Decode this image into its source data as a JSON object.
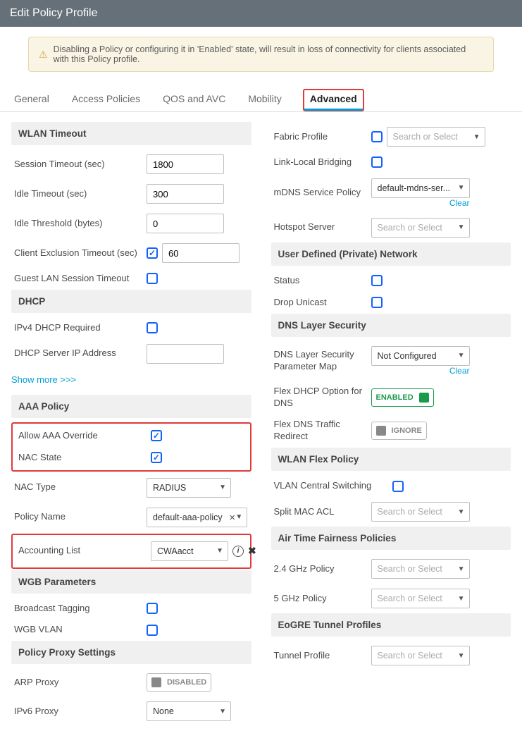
{
  "header": {
    "title": "Edit Policy Profile"
  },
  "warning": {
    "text": "Disabling a Policy or configuring it in 'Enabled' state, will result in loss of connectivity for clients associated with this Policy profile."
  },
  "tabs": {
    "general": "General",
    "access": "Access Policies",
    "qos": "QOS and AVC",
    "mobility": "Mobility",
    "advanced": "Advanced"
  },
  "link_showmore": "Show more >>>",
  "link_clear": "Clear",
  "placeholder_search": "Search or Select",
  "left": {
    "sec_wlan_timeout": "WLAN Timeout",
    "session_timeout": "Session Timeout (sec)",
    "session_timeout_val": "1800",
    "idle_timeout": "Idle Timeout (sec)",
    "idle_timeout_val": "300",
    "idle_threshold": "Idle Threshold (bytes)",
    "idle_threshold_val": "0",
    "client_exclusion": "Client Exclusion Timeout (sec)",
    "client_exclusion_val": "60",
    "guest_lan": "Guest LAN Session Timeout",
    "sec_dhcp": "DHCP",
    "ipv4_dhcp_req": "IPv4 DHCP Required",
    "dhcp_server_ip": "DHCP Server IP Address",
    "sec_aaa": "AAA Policy",
    "allow_aaa": "Allow AAA Override",
    "nac_state": "NAC State",
    "nac_type": "NAC Type",
    "nac_type_val": "RADIUS",
    "policy_name": "Policy Name",
    "policy_name_val": "default-aaa-policy",
    "accounting_list": "Accounting List",
    "accounting_list_val": "CWAacct",
    "sec_wgb": "WGB Parameters",
    "broadcast_tagging": "Broadcast Tagging",
    "wgb_vlan": "WGB VLAN",
    "sec_proxy": "Policy Proxy Settings",
    "arp_proxy": "ARP Proxy",
    "arp_proxy_val": "DISABLED",
    "ipv6_proxy": "IPv6 Proxy",
    "ipv6_proxy_val": "None"
  },
  "right": {
    "fabric_profile": "Fabric Profile",
    "link_local": "Link-Local Bridging",
    "mdns": "mDNS Service Policy",
    "mdns_val": "default-mdns-ser...",
    "hotspot": "Hotspot Server",
    "sec_udn": "User Defined (Private) Network",
    "status": "Status",
    "drop_unicast": "Drop Unicast",
    "sec_dns": "DNS Layer Security",
    "dns_param": "DNS Layer Security Parameter Map",
    "dns_param_val": "Not Configured",
    "flex_dhcp": "Flex DHCP Option for DNS",
    "flex_dhcp_val": "ENABLED",
    "flex_dns": "Flex DNS Traffic Redirect",
    "flex_dns_val": "IGNORE",
    "sec_wlanflex": "WLAN Flex Policy",
    "vlan_central": "VLAN Central Switching",
    "split_mac": "Split MAC ACL",
    "sec_atf": "Air Time Fairness Policies",
    "p24": "2.4 GHz Policy",
    "p5": "5 GHz Policy",
    "sec_eogre": "EoGRE Tunnel Profiles",
    "tunnel": "Tunnel Profile"
  }
}
